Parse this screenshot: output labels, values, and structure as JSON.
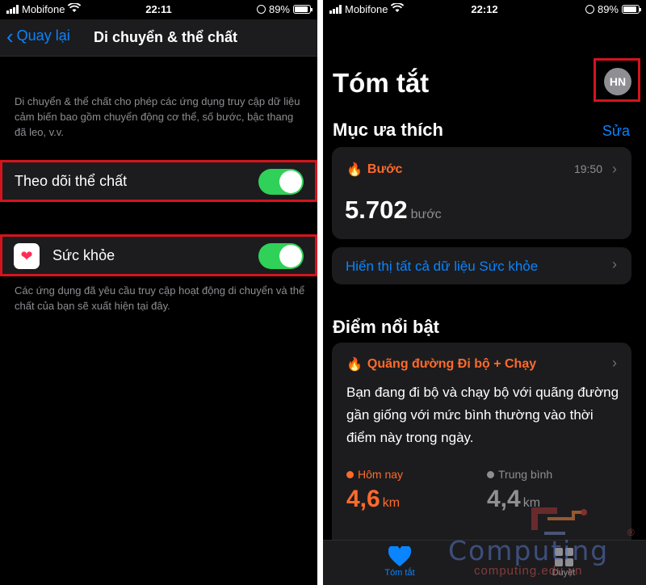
{
  "left": {
    "status": {
      "carrier": "Mobifone",
      "time": "22:11",
      "battery": "89%",
      "battery_level": 0.89
    },
    "nav": {
      "back_label": "Quay lại",
      "title": "Di chuyển & thể chất"
    },
    "description": "Di chuyển & thể chất cho phép các ứng dụng truy cập dữ liệu cảm biến bao gồm chuyển động cơ thể, số bước, bậc thang đã leo, v.v.",
    "fitness_tracking": {
      "label": "Theo dõi thể chất",
      "on": true
    },
    "health_app": {
      "label": "Sức khỏe",
      "on": true,
      "icon": "heart-icon"
    },
    "footer": "Các ứng dụng đã yêu cầu truy cập hoạt động di chuyển và thể chất của bạn sẽ xuất hiện tại đây."
  },
  "right": {
    "status": {
      "carrier": "Mobifone",
      "time": "22:12",
      "battery": "89%",
      "battery_level": 0.89
    },
    "title": "Tóm tắt",
    "avatar_initials": "HN",
    "favorites": {
      "title": "Mục ưa thích",
      "edit_label": "Sửa",
      "steps_card": {
        "label": "Bước",
        "time": "19:50",
        "value": "5.702",
        "unit": "bước"
      },
      "show_all_label": "Hiển thị tất cả dữ liệu Sức khỏe"
    },
    "highlights": {
      "title": "Điểm nổi bật",
      "card": {
        "label": "Quãng đường Đi bộ + Chạy",
        "text": "Bạn đang đi bộ và chạy bộ với quãng đường gần giống với mức bình thường vào thời điểm này trong ngày.",
        "today_label": "Hôm nay",
        "today_value": "4,6",
        "today_unit": "km",
        "average_label": "Trung bình",
        "average_value": "4,4",
        "average_unit": "km"
      }
    },
    "tabs": [
      {
        "label": "Tóm tắt",
        "active": true,
        "icon": "heart-icon"
      },
      {
        "label": "Duyệt",
        "active": false,
        "icon": "grid-icon"
      }
    ]
  },
  "watermark": {
    "text": "Computing",
    "url": "computing.edu.vn",
    "registered": "®"
  },
  "colors": {
    "accent": "#0a84ff",
    "toggle_on": "#30d158",
    "highlight_border": "#d4141c",
    "health_orange": "#ff6a2b"
  }
}
